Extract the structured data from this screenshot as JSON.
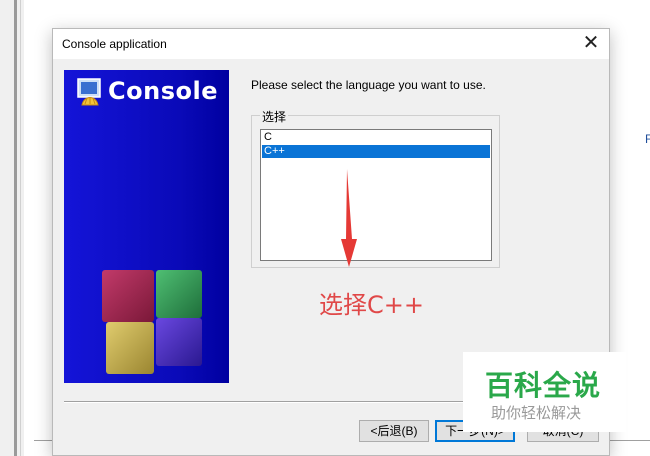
{
  "dialog": {
    "title": "Console application",
    "banner_title": "Console",
    "instruction": "Please select the language you want to use.",
    "group_label": "选择",
    "languages": [
      {
        "label": "C",
        "selected": false
      },
      {
        "label": "C++",
        "selected": true
      }
    ],
    "buttons": {
      "back": "<后退(B)",
      "next": "下一步(N)>",
      "cancel": "取消(C)"
    }
  },
  "annotation": {
    "text": "选择C++",
    "color": "#e04848"
  },
  "watermark": {
    "main": "百科全说",
    "sub": "助你轻松解决"
  },
  "background": {
    "right_glyph": "F"
  },
  "colors": {
    "banner": "#1414d8",
    "selection": "#0a74d6",
    "watermark_green": "#2aa84a"
  }
}
